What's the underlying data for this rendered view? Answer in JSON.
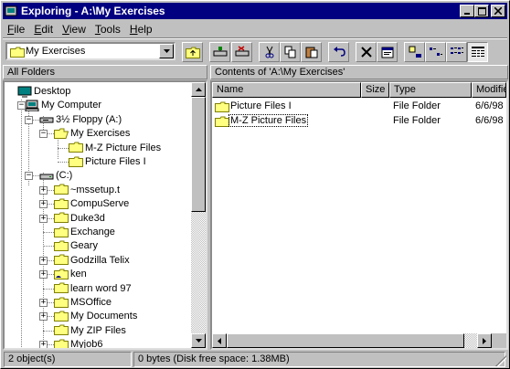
{
  "window": {
    "title": "Exploring - A:\\My Exercises"
  },
  "menu": {
    "items": [
      {
        "key": "F",
        "rest": "ile"
      },
      {
        "key": "E",
        "rest": "dit"
      },
      {
        "key": "V",
        "rest": "iew"
      },
      {
        "key": "T",
        "rest": "ools"
      },
      {
        "key": "H",
        "rest": "elp"
      }
    ]
  },
  "address": {
    "value": "My Exercises"
  },
  "left_header": "All Folders",
  "right_header": "Contents of 'A:\\My Exercises'",
  "tree": [
    {
      "label": "Desktop",
      "icon": "desktop-icon",
      "level": 0,
      "pm": ""
    },
    {
      "label": "My Computer",
      "icon": "computer-icon",
      "level": 1,
      "pm": "-"
    },
    {
      "label": "3½ Floppy (A:)",
      "icon": "floppy-icon",
      "level": 2,
      "pm": "-"
    },
    {
      "label": "My Exercises",
      "icon": "open-folder-icon",
      "level": 3,
      "pm": "-"
    },
    {
      "label": "M-Z Picture Files",
      "icon": "folder-icon",
      "level": 4,
      "pm": ""
    },
    {
      "label": "Picture Files I",
      "icon": "folder-icon",
      "level": 4,
      "pm": ""
    },
    {
      "label": "(C:)",
      "icon": "drive-icon",
      "level": 2,
      "pm": "-"
    },
    {
      "label": "~mssetup.t",
      "icon": "folder-icon",
      "level": 3,
      "pm": "+"
    },
    {
      "label": "CompuServe",
      "icon": "folder-icon",
      "level": 3,
      "pm": "+"
    },
    {
      "label": "Duke3d",
      "icon": "folder-icon",
      "level": 3,
      "pm": "+"
    },
    {
      "label": "Exchange",
      "icon": "folder-icon",
      "level": 3,
      "pm": ""
    },
    {
      "label": "Geary",
      "icon": "folder-icon",
      "level": 3,
      "pm": ""
    },
    {
      "label": "Godzilla Telix",
      "icon": "folder-icon",
      "level": 3,
      "pm": "+"
    },
    {
      "label": "ken",
      "icon": "shared-folder-icon",
      "level": 3,
      "pm": "+"
    },
    {
      "label": "learn word 97",
      "icon": "folder-icon",
      "level": 3,
      "pm": ""
    },
    {
      "label": "MSOffice",
      "icon": "folder-icon",
      "level": 3,
      "pm": "+"
    },
    {
      "label": "My Documents",
      "icon": "folder-icon",
      "level": 3,
      "pm": "+"
    },
    {
      "label": "My ZIP Files",
      "icon": "folder-icon",
      "level": 3,
      "pm": ""
    },
    {
      "label": "Myjob6",
      "icon": "folder-icon",
      "level": 3,
      "pm": "+"
    }
  ],
  "columns": [
    "Name",
    "Size",
    "Type",
    "Modified"
  ],
  "files": [
    {
      "name": "Picture Files I",
      "size": "",
      "type": "File Folder",
      "modified": "6/6/98"
    },
    {
      "name": "M-Z Picture Files",
      "size": "",
      "type": "File Folder",
      "modified": "6/6/98"
    }
  ],
  "status": {
    "objects": "2 object(s)",
    "space": "0 bytes (Disk free space: 1.38MB)"
  },
  "colors": {
    "titlebar": "#000080",
    "face": "#c0c0c0",
    "folder": "#ffff80"
  }
}
